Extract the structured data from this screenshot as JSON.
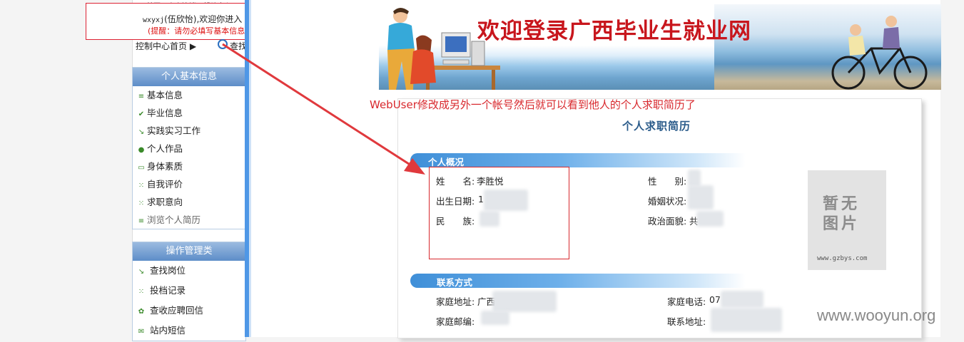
{
  "left": {
    "top_cut": "首页 | 个人注销 | 帮助中心",
    "welcome_user": "wxyxj",
    "welcome_name": "(伍欣怡),",
    "welcome_text": "欢迎你进入",
    "reminder": "(提醒：请勿必填写基本信息",
    "breadcrumb": "控制中心首页 ▶",
    "search_label": "查找",
    "panel1_title": "个人基本信息",
    "panel1_items": [
      "基本信息",
      "毕业信息",
      "实践实习工作",
      "个人作品",
      "身体素质",
      "自我评价",
      "求职意向",
      "浏览个人简历"
    ],
    "panel2_title": "操作管理类",
    "panel2_items": [
      "查找岗位",
      "投档记录",
      "查收应聘回信",
      "站内短信"
    ]
  },
  "banner": {
    "title": "欢迎登录广西毕业生就业网"
  },
  "annotation": "WebUser修改成另外一个帐号然后就可以看到他人的个人求职简历了",
  "resume": {
    "title": "个人求职简历",
    "section1": "个人概况",
    "name_label": "姓　　名:",
    "name_value": "李胜悦",
    "birth_label": "出生日期:",
    "birth_value": "1",
    "ethnic_label": "民　　族:",
    "gender_label": "性　　别:",
    "marital_label": "婚姻状况:",
    "political_label": "政治面貌:",
    "political_value": "共",
    "section2": "联系方式",
    "home_addr_label": "家庭地址:",
    "home_addr_value": "广西",
    "home_zip_label": "家庭邮编:",
    "home_tel_label": "家庭电话:",
    "home_tel_value": "07",
    "contact_addr_label": "联系地址:",
    "photo_line1": "暂无",
    "photo_line2": "图片",
    "photo_url": "www.gzbys.com"
  },
  "watermark": "www.wooyun.org",
  "colors": {
    "annotation_red": "#d8282d",
    "panel_blue": "#5d8dc8",
    "divider_blue": "#4f97e6",
    "banner_title_red": "#c8161d"
  }
}
